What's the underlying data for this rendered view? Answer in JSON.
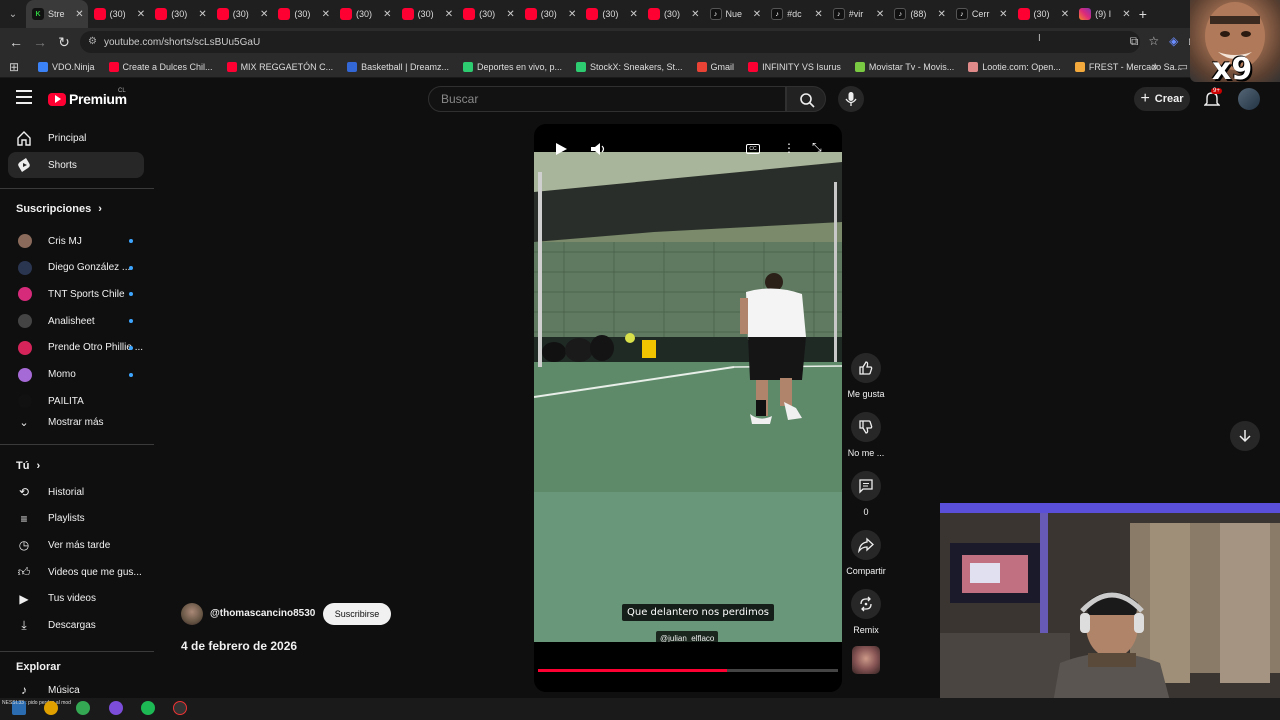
{
  "browser": {
    "tabs": [
      {
        "label": "Stre",
        "icon": "green-app-icon",
        "active": true
      },
      {
        "label": "(30)",
        "icon": "youtube-icon"
      },
      {
        "label": "(30)",
        "icon": "youtube-icon"
      },
      {
        "label": "(30)",
        "icon": "youtube-icon"
      },
      {
        "label": "(30)",
        "icon": "youtube-icon"
      },
      {
        "label": "(30)",
        "icon": "youtube-icon"
      },
      {
        "label": "(30)",
        "icon": "youtube-icon"
      },
      {
        "label": "(30)",
        "icon": "youtube-icon"
      },
      {
        "label": "(30)",
        "icon": "youtube-icon"
      },
      {
        "label": "(30)",
        "icon": "youtube-icon"
      },
      {
        "label": "(30)",
        "icon": "youtube-icon"
      },
      {
        "label": "Nue",
        "icon": "tiktok-icon"
      },
      {
        "label": "#dc",
        "icon": "tiktok-icon"
      },
      {
        "label": "#vir",
        "icon": "tiktok-icon"
      },
      {
        "label": "(88)",
        "icon": "tiktok-icon"
      },
      {
        "label": "Cerr",
        "icon": "tiktok-icon"
      },
      {
        "label": "(30)",
        "icon": "youtube-icon"
      },
      {
        "label": "(9) I",
        "icon": "instagram-icon"
      }
    ],
    "url": "youtube.com/shorts/scLsBUu5GaU",
    "bookmarks": [
      {
        "label": "VDO.Ninja",
        "color": "#3b82f6"
      },
      {
        "label": "Create a Dulces Chil...",
        "color": "#ff0033"
      },
      {
        "label": "MIX REGGAETÓN C...",
        "color": "#ff0033"
      },
      {
        "label": "Basketball | Dreamz...",
        "color": "#3367d6"
      },
      {
        "label": "Deportes en vivo, p...",
        "color": "#2ecc71"
      },
      {
        "label": "StockX: Sneakers, St...",
        "color": "#2ecc71"
      },
      {
        "label": "Gmail",
        "color": "#ea4335"
      },
      {
        "label": "INFINITY VS Isurus",
        "color": "#ff0033"
      },
      {
        "label": "Movistar Tv - Movis...",
        "color": "#7ac943"
      },
      {
        "label": "Lootie.com: Open...",
        "color": "#e08a8a"
      },
      {
        "label": "FREST - Mercado Sa...",
        "color": "#f3a93b"
      }
    ]
  },
  "overlay": {
    "multiplier": "x9"
  },
  "header": {
    "logo_text": "Premium",
    "logo_country": "CL",
    "search_placeholder": "Buscar",
    "create_label": "Crear",
    "notification_count": "9+"
  },
  "sidebar": {
    "main": [
      {
        "label": "Principal",
        "icon": "home-icon"
      },
      {
        "label": "Shorts",
        "icon": "shorts-icon",
        "active": true
      }
    ],
    "subscriptions_title": "Suscripciones",
    "subscriptions": [
      {
        "label": "Cris MJ",
        "color": "#8a6a5a"
      },
      {
        "label": "Diego González ...",
        "color": "#2a3550"
      },
      {
        "label": "TNT Sports Chile",
        "color": "#d62a7a"
      },
      {
        "label": "Analisheet",
        "color": "#444444"
      },
      {
        "label": "Prende Otro Phillie ...",
        "color": "#d4245a"
      },
      {
        "label": "Momo",
        "color": "#a66ad6"
      },
      {
        "label": "PAILITA",
        "color": "#111111"
      }
    ],
    "show_more": "Mostrar más",
    "you_title": "Tú",
    "you_items": [
      {
        "label": "Historial",
        "icon": "history-icon"
      },
      {
        "label": "Playlists",
        "icon": "playlist-icon"
      },
      {
        "label": "Ver más tarde",
        "icon": "clock-icon"
      },
      {
        "label": "Videos que me gus...",
        "icon": "thumbs-up-icon"
      },
      {
        "label": "Tus videos",
        "icon": "video-icon"
      },
      {
        "label": "Descargas",
        "icon": "download-icon"
      }
    ],
    "explore_title": "Explorar",
    "explore_items": [
      {
        "label": "Música",
        "icon": "music-icon"
      }
    ]
  },
  "video": {
    "caption": "Que delantero nos perdimos",
    "tag": "@julian_elflaco",
    "progress": 0.63
  },
  "actions": {
    "like": "Me gusta",
    "dislike": "No me ...",
    "comments": "0",
    "share": "Compartir",
    "remix": "Remix"
  },
  "channel": {
    "handle": "@thomascancino8530",
    "subscribe_label": "Suscribirse",
    "date": "4 de febrero de 2026"
  },
  "taskbar": {
    "notice": "NESSI.33 : pido perdon al mod"
  }
}
